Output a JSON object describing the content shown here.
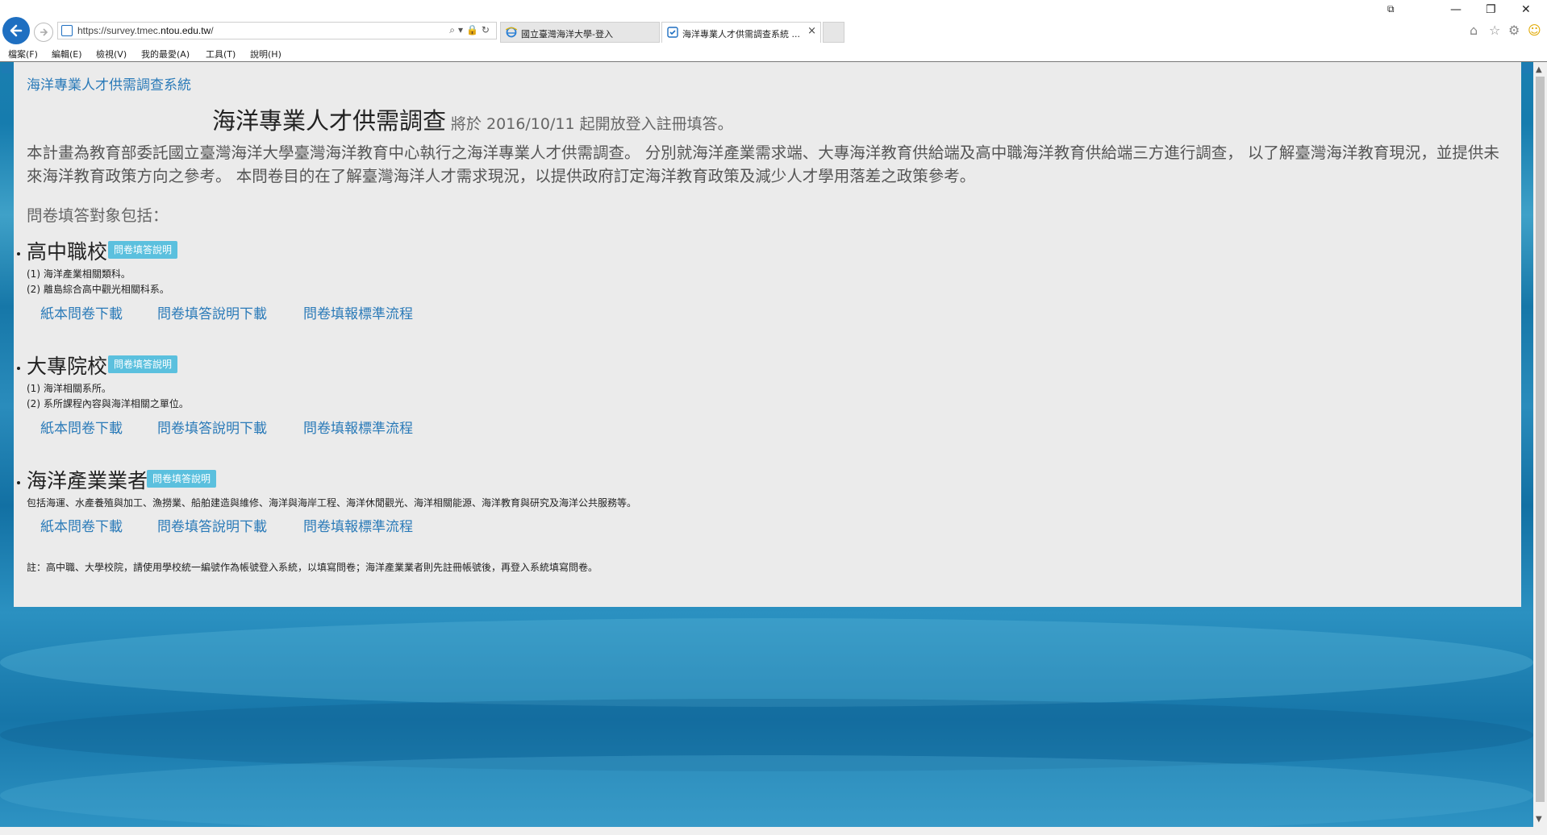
{
  "browser": {
    "url_prefix": "https://survey.tmec.",
    "url_domain": "ntou.edu.tw",
    "url_suffix": "/",
    "address_tools": "⌕▾🔒↻",
    "tabs": [
      {
        "label": "國立臺灣海洋大學-登入"
      },
      {
        "label": "海洋專業人才供需調查系統 ..."
      }
    ],
    "close_glyph": "×",
    "menu": [
      "檔案(F)",
      "編輯(E)",
      "檢視(V)",
      "我的最愛(A)",
      "工具(T)",
      "說明(H)"
    ]
  },
  "page": {
    "site_title": "海洋專業人才供需調查系統",
    "headline_main": "海洋專業人才供需調查",
    "headline_sub": "將於 2016/10/11 起開放登入註冊填答。",
    "intro": "本計畫為教育部委託國立臺灣海洋大學臺灣海洋教育中心執行之海洋專業人才供需調查。 分別就海洋產業需求端、大專海洋教育供給端及高中職海洋教育供給端三方進行調查， 以了解臺灣海洋教育現況，並提供未來海洋教育政策方向之參考。 本問卷目的在了解臺灣海洋人才需求現況，以提供政府訂定海洋教育政策及減少人才學用落差之政策參考。",
    "audience_label": "問卷填答對象包括：",
    "groups": [
      {
        "title": "高中職校",
        "badge": "問卷填答說明",
        "lines": [
          "(1) 海洋產業相關類科。",
          "(2) 離島綜合高中觀光相關科系。"
        ],
        "links": [
          "紙本問卷下載",
          "問卷填答說明下載",
          "問卷填報標準流程"
        ]
      },
      {
        "title": "大專院校",
        "badge": "問卷填答說明",
        "lines": [
          "(1) 海洋相關系所。",
          "(2) 系所課程內容與海洋相關之單位。"
        ],
        "links": [
          "紙本問卷下載",
          "問卷填答說明下載",
          "問卷填報標準流程"
        ]
      },
      {
        "title": "海洋產業業者",
        "badge": "問卷填答說明",
        "lines": [
          "包括海運、水產養殖與加工、漁撈業、船舶建造與維修、海洋與海岸工程、海洋休閒觀光、海洋相關能源、海洋教育與研究及海洋公共服務等。"
        ],
        "links": [
          "紙本問卷下載",
          "問卷填答說明下載",
          "問卷填報標準流程"
        ]
      }
    ],
    "note": "註：高中職、大學校院，請使用學校統一編號作為帳號登入系統，以填寫問卷；海洋產業業者則先註冊帳號後，再登入系統填寫問卷。"
  }
}
